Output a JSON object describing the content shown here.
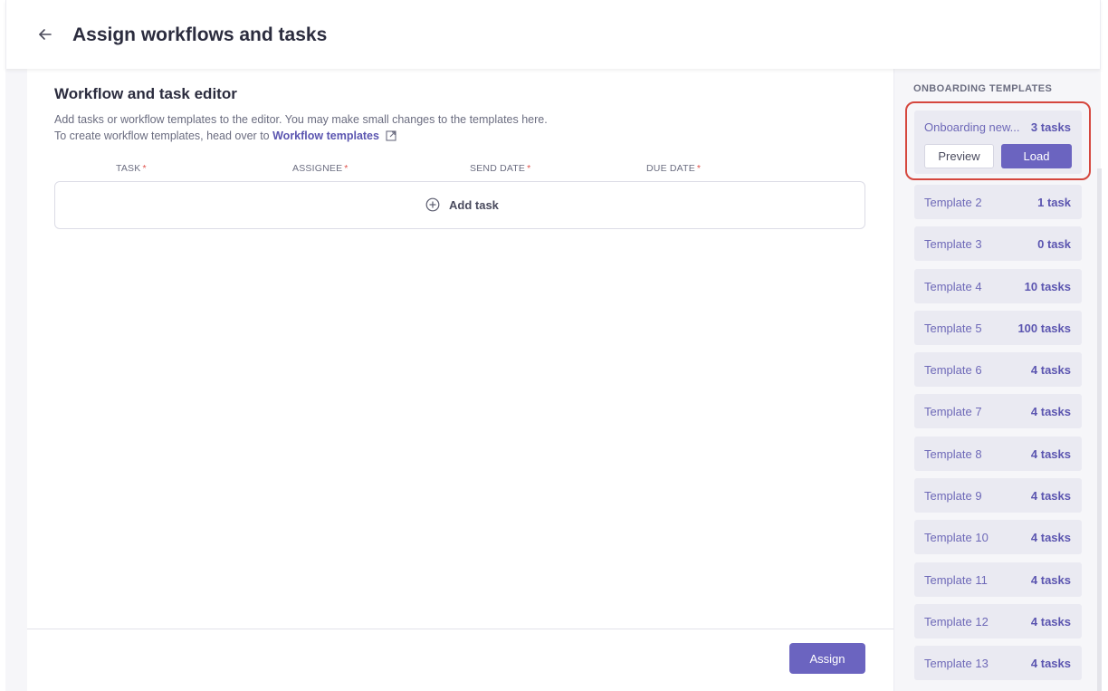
{
  "header": {
    "title": "Assign workflows and tasks"
  },
  "editor": {
    "title": "Workflow and task editor",
    "description": "Add tasks or workflow templates to the editor. You may make small changes to the templates here.",
    "link_prefix": "To create workflow templates, head over to",
    "link_label": "Workflow templates",
    "columns": [
      {
        "label": "TASK",
        "required": "*"
      },
      {
        "label": "ASSIGNEE",
        "required": "*"
      },
      {
        "label": "SEND DATE",
        "required": "*"
      },
      {
        "label": "DUE DATE",
        "required": "*"
      }
    ],
    "add_task_label": "Add task"
  },
  "footer": {
    "assign_label": "Assign"
  },
  "sidebar": {
    "title": "ONBOARDING TEMPLATES",
    "selected": {
      "name": "Onboarding new...",
      "count": "3 tasks",
      "preview_label": "Preview",
      "load_label": "Load"
    },
    "templates": [
      {
        "name": "Template 2",
        "count": "1 task"
      },
      {
        "name": "Template 3",
        "count": "0 task"
      },
      {
        "name": "Template 4",
        "count": "10 tasks"
      },
      {
        "name": "Template 5",
        "count": "100 tasks"
      },
      {
        "name": "Template 6",
        "count": "4 tasks"
      },
      {
        "name": "Template 7",
        "count": "4 tasks"
      },
      {
        "name": "Template 8",
        "count": "4 tasks"
      },
      {
        "name": "Template 9",
        "count": "4 tasks"
      },
      {
        "name": "Template 10",
        "count": "4 tasks"
      },
      {
        "name": "Template 11",
        "count": "4 tasks"
      },
      {
        "name": "Template 12",
        "count": "4 tasks"
      },
      {
        "name": "Template 13",
        "count": "4 tasks"
      }
    ]
  },
  "colors": {
    "accent": "#6b64c0",
    "link": "#5b55b0",
    "highlight_border": "#d5473e",
    "required": "#e0524c"
  }
}
